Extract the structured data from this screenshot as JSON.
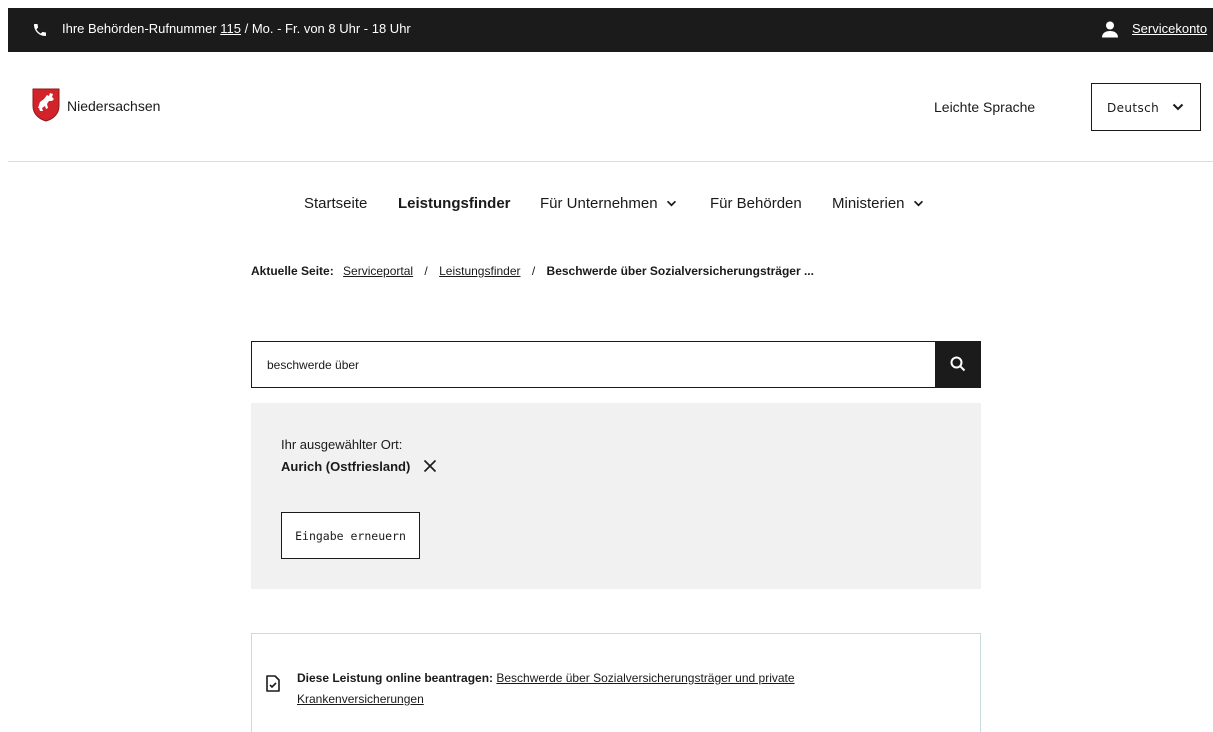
{
  "topbar": {
    "hotline_prefix": "Ihre Behörden-Rufnummer ",
    "hotline_number": "115",
    "hotline_suffix": " / Mo. - Fr. von 8 Uhr - 18 Uhr",
    "service_account": "Servicekonto",
    "phone_icon": "phone-icon",
    "user_icon": "user-icon"
  },
  "header": {
    "brand": "Niedersachsen",
    "easy_language": "Leichte Sprache",
    "language": "Deutsch"
  },
  "nav": {
    "items": [
      {
        "label": "Startseite"
      },
      {
        "label": "Leistungsfinder"
      },
      {
        "label": "Für Unternehmen"
      },
      {
        "label": "Für Behörden"
      },
      {
        "label": "Ministerien"
      }
    ]
  },
  "breadcrumb": {
    "label": "Aktuelle Seite:",
    "items": [
      "Serviceportal",
      "Leistungsfinder"
    ],
    "separator": "/",
    "current": "Beschwerde über Sozialversicherungsträger ..."
  },
  "search": {
    "value": "beschwerde über"
  },
  "location": {
    "label": "Ihr ausgewählter Ort:",
    "place": "Aurich (Ostfriesland)",
    "renew_button": "Eingabe erneuern"
  },
  "apply": {
    "prefix": "Diese Leistung online beantragen:",
    "link": "Beschwerde über Sozialversicherungsträger und private Krankenversicherungen"
  },
  "colors": {
    "topbar_bg": "#1b1b1b",
    "panel_bg": "#f1f1f1",
    "logo_red": "#d2232a",
    "card_border": "#c9dbe0"
  }
}
